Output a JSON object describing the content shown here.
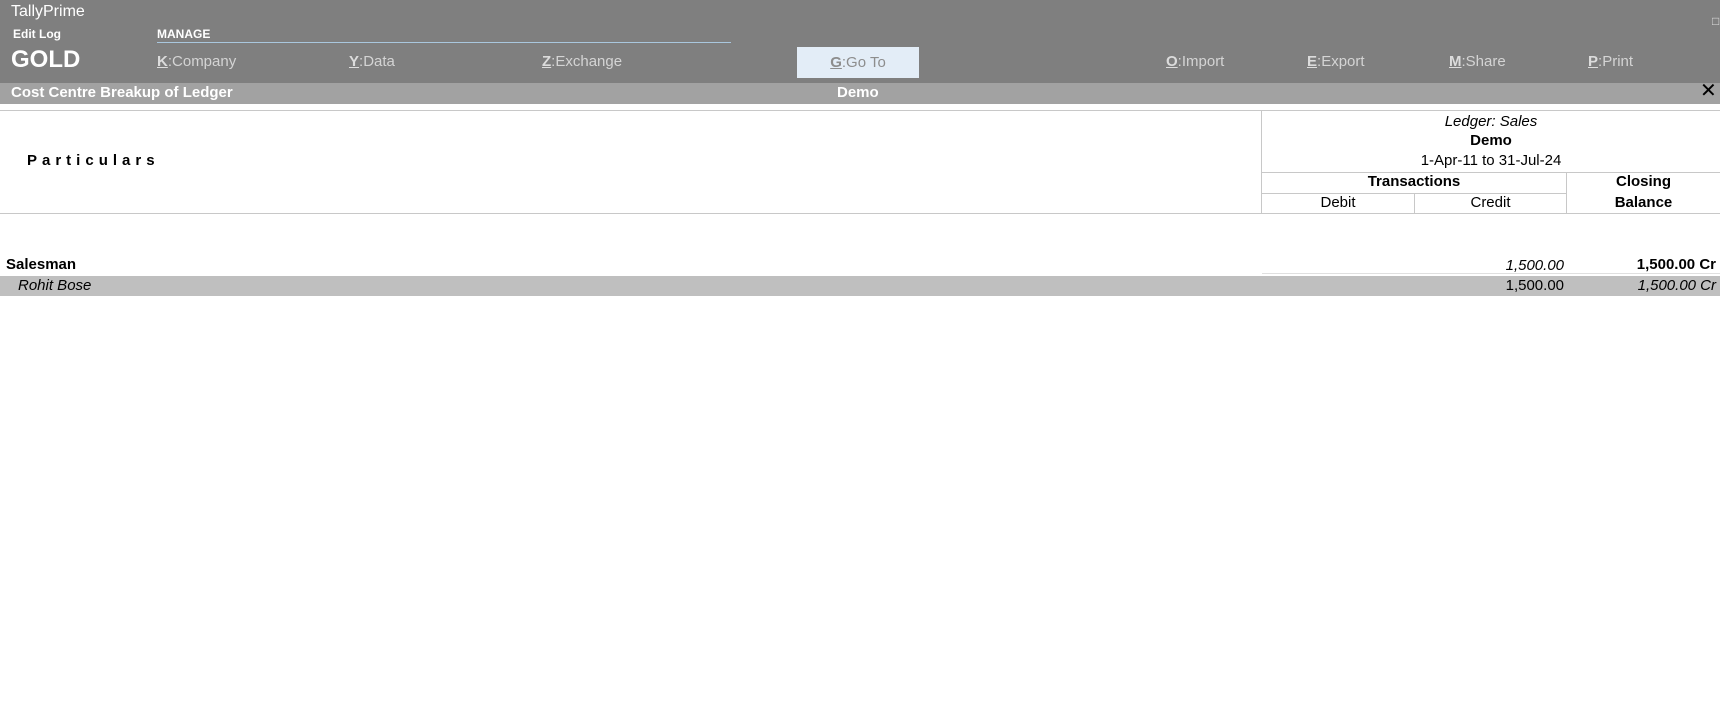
{
  "app": {
    "title": "TallyPrime",
    "edit_log": "Edit Log",
    "edition": "GOLD",
    "manage_label": "MANAGE"
  },
  "menu": [
    {
      "key": "K",
      "label": "Company"
    },
    {
      "key": "Y",
      "label": "Data"
    },
    {
      "key": "Z",
      "label": "Exchange"
    },
    {
      "key": "G",
      "label": "Go To"
    },
    {
      "key": "O",
      "label": "Import"
    },
    {
      "key": "E",
      "label": "Export"
    },
    {
      "key": "M",
      "label": "Share"
    },
    {
      "key": "P",
      "label": "Print"
    }
  ],
  "report": {
    "title": "Cost Centre Breakup of Ledger",
    "company": "Demo",
    "close_symbol": "✕"
  },
  "table_header": {
    "particulars": "Particulars",
    "ledger": "Ledger: Sales",
    "company": "Demo",
    "period": "1-Apr-11 to 31-Jul-24",
    "transactions": "Transactions",
    "debit": "Debit",
    "credit": "Credit",
    "closing_line1": "Closing",
    "closing_line2": "Balance"
  },
  "rows": [
    {
      "name": "Salesman",
      "debit": "",
      "credit": "1,500.00",
      "closing": "1,500.00 Cr"
    },
    {
      "name": "Rohit Bose",
      "debit": "",
      "credit": "1,500.00",
      "closing": "1,500.00 Cr"
    }
  ],
  "colors": {
    "topbar": "#7f7f7f",
    "report_bar": "#a2a2a2",
    "selected_row": "#bfbfbf",
    "goto_bg": "#e3edf7"
  }
}
